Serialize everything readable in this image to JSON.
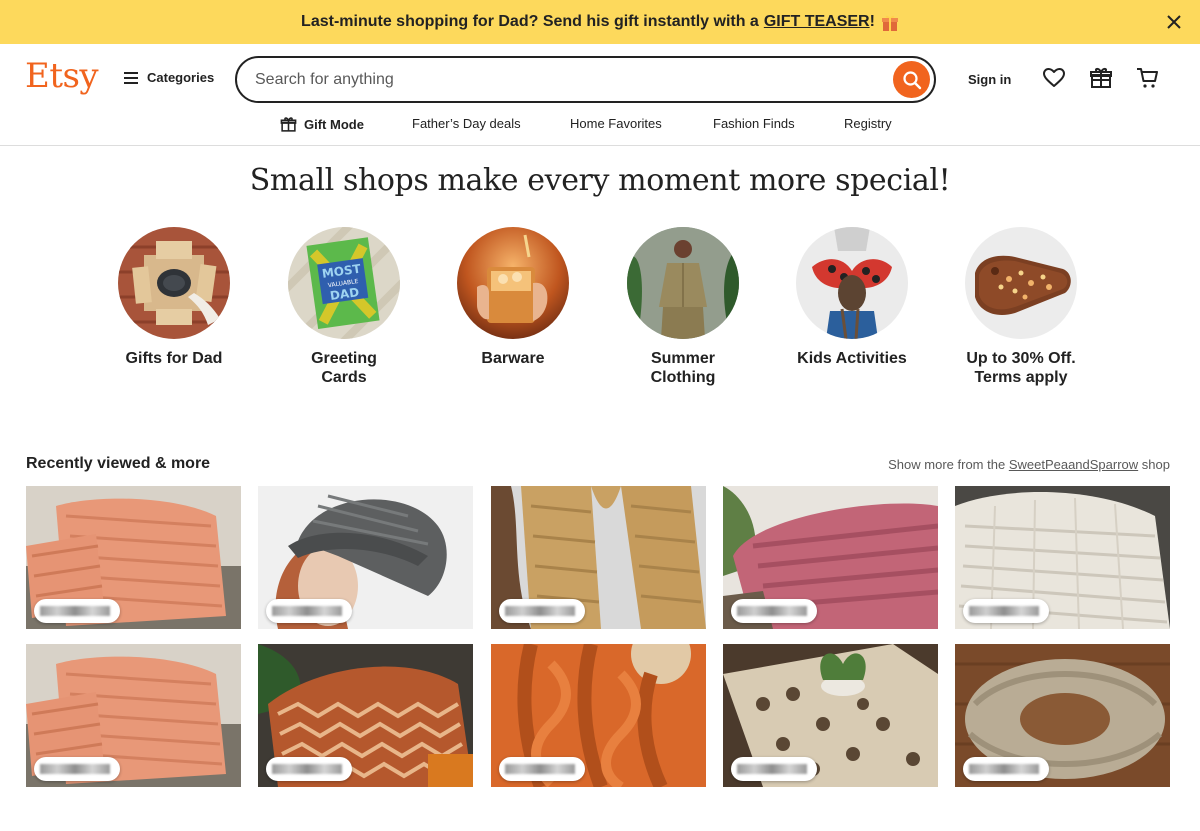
{
  "banner": {
    "text": "Last-minute shopping for Dad? Send his gift instantly with a",
    "link": "GIFT TEASER",
    "suffix": "!"
  },
  "header": {
    "logo": "Etsy",
    "categories_label": "Categories",
    "search_placeholder": "Search for anything",
    "signin_label": "Sign in"
  },
  "subnav": {
    "items": [
      "Gift Mode",
      "Father’s Day deals",
      "Home Favorites",
      "Fashion Finds",
      "Registry"
    ]
  },
  "hero": {
    "title": "Small shops make every moment more special!",
    "circles": [
      {
        "label": "Gifts for Dad"
      },
      {
        "label": "Greeting\nCards",
        "card_text_1": "MOST",
        "card_text_2": "VALUABLE",
        "card_text_3": "DAD"
      },
      {
        "label": "Barware"
      },
      {
        "label": "Summer\nClothing"
      },
      {
        "label": "Kids Activities"
      },
      {
        "label": "Up to 30% Off.\nTerms apply"
      }
    ]
  },
  "recently_viewed": {
    "title": "Recently viewed & more",
    "more_prefix": "Show more from the",
    "shop_name": "SweetPeaandSparrow",
    "more_suffix": "shop"
  },
  "colors": {
    "banner": "#fdd95c",
    "brand": "#f1641e"
  }
}
